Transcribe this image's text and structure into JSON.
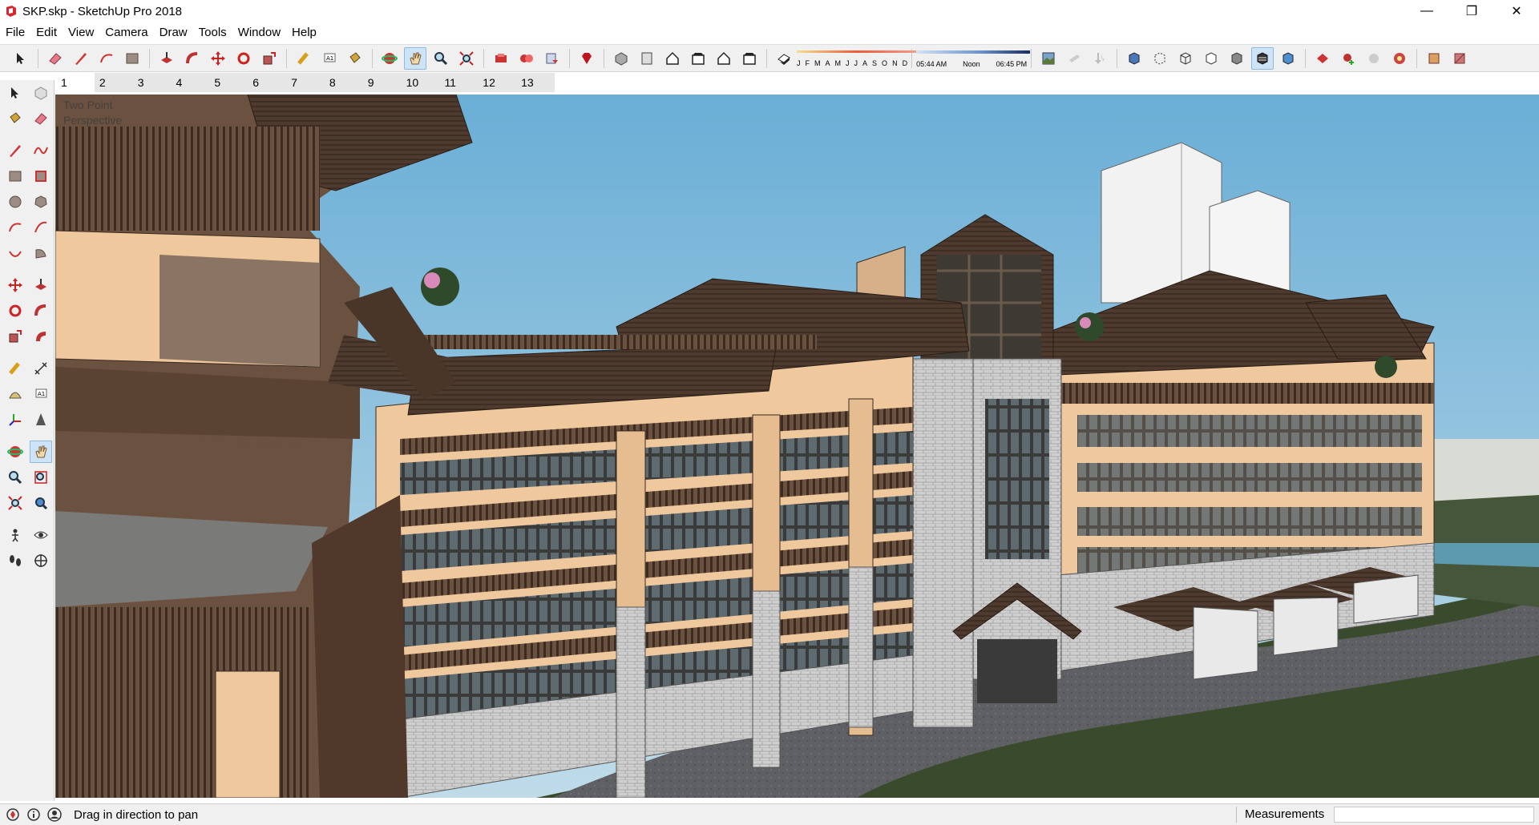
{
  "window": {
    "title": "SKP.skp - SketchUp Pro 2018",
    "minimize_glyph": "—",
    "restore_glyph": "❐",
    "close_glyph": "✕"
  },
  "menu": {
    "items": [
      "File",
      "Edit",
      "View",
      "Camera",
      "Draw",
      "Tools",
      "Window",
      "Help"
    ]
  },
  "toolbar": {
    "shadow_months": [
      "J",
      "F",
      "M",
      "A",
      "M",
      "J",
      "J",
      "A",
      "S",
      "O",
      "N",
      "D"
    ],
    "time_start": "05:44 AM",
    "time_noon": "Noon",
    "time_end": "06:45 PM",
    "active_tool": "pan-icon"
  },
  "scenes": {
    "tabs": [
      "1",
      "2",
      "3",
      "4",
      "5",
      "6",
      "7",
      "8",
      "9",
      "10",
      "11",
      "12",
      "13"
    ],
    "active": "1"
  },
  "viewport": {
    "scene_label_line1": "Two Point",
    "scene_label_line2": "Perspective"
  },
  "status": {
    "hint": "Drag in direction to pan",
    "measurements_label": "Measurements",
    "measurements_value": ""
  },
  "colors": {
    "sky": "#7ab8d6",
    "grass": "#3a4a2c",
    "road": "#5b5e62",
    "plaster": "#f1cba2",
    "wood": "#5b4331",
    "stone": "#cfcfcf",
    "accent_active": "#cde3f7"
  }
}
